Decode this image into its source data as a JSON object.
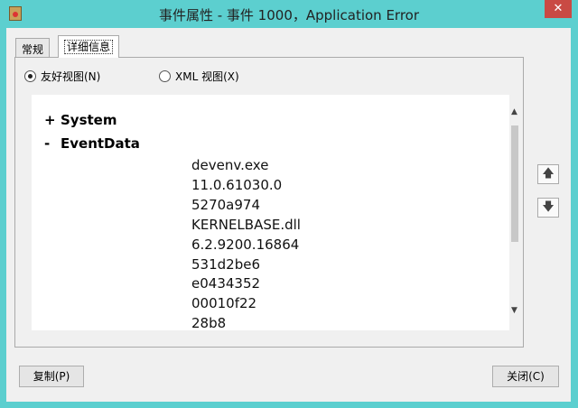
{
  "window": {
    "title": "事件属性 - 事件 1000，Application Error",
    "close_glyph": "✕"
  },
  "tabs": [
    {
      "label": "常规"
    },
    {
      "label": "详细信息"
    }
  ],
  "view_options": [
    {
      "label": "友好视图(N)",
      "selected": true
    },
    {
      "label": "XML 视图(X)",
      "selected": false
    }
  ],
  "tree": {
    "system": {
      "toggle": "+",
      "label": "System"
    },
    "eventdata": {
      "toggle": "-",
      "label": "EventData"
    }
  },
  "values": [
    "devenv.exe",
    "11.0.61030.0",
    "5270a974",
    "KERNELBASE.dll",
    "6.2.9200.16864",
    "531d2be6",
    "e0434352",
    "00010f22",
    "28b8"
  ],
  "nav": {
    "up": "🡅",
    "down": "🡇"
  },
  "buttons": {
    "copy": "复制(P)",
    "close": "关闭(C)"
  }
}
